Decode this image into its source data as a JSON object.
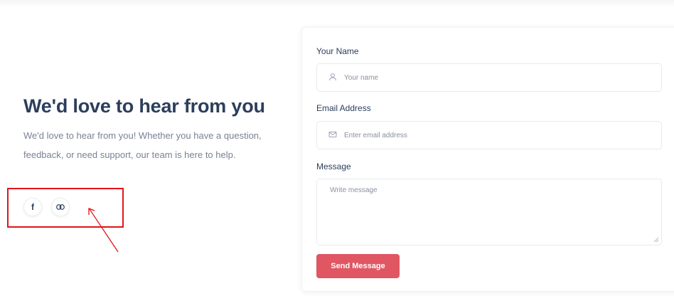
{
  "intro": {
    "heading": "We'd love to hear from you",
    "description": "We'd love to hear from you! Whether you have a question, feedback, or need support, our team is here to help."
  },
  "social": {
    "icons": [
      "facebook-icon",
      "link-icon"
    ],
    "highlight_color": "#e0141b",
    "facebook_glyph": "f"
  },
  "form": {
    "name_label": "Your Name",
    "name_placeholder": "Your name",
    "email_label": "Email Address",
    "email_placeholder": "Enter email address",
    "message_label": "Message",
    "message_placeholder": "Write message",
    "submit_label": "Send Message",
    "submit_color": "#e05663"
  }
}
